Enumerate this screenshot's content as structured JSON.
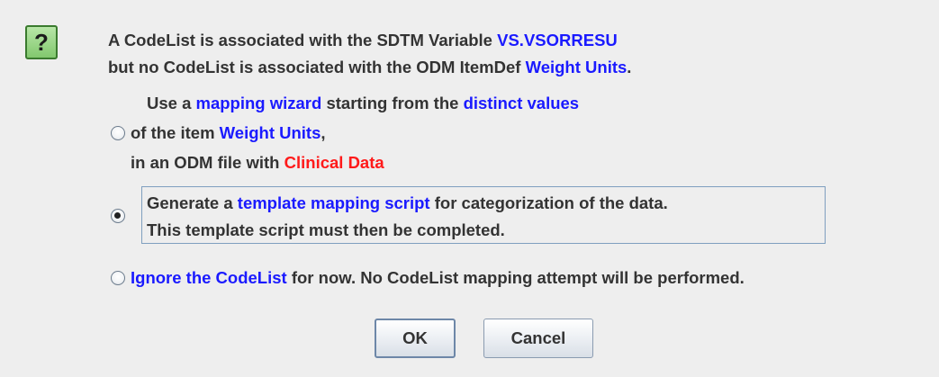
{
  "icon": {
    "name": "question-icon",
    "glyph": "?"
  },
  "message": {
    "line1": {
      "text": "A CodeList is associated with the SDTM Variable ",
      "highlight": "VS.VSORRESU"
    },
    "line2": {
      "text": "but no CodeList is associated with the ODM ItemDef ",
      "highlight": "Weight Units",
      "suffix": "."
    }
  },
  "options": [
    {
      "selected": false,
      "l1": {
        "a": "Use a ",
        "b": "mapping wizard",
        "c": " starting from the ",
        "d": "distinct values"
      },
      "l2": {
        "a": "of the item ",
        "b": "Weight Units",
        "c": ","
      },
      "l3": {
        "a": "in an ODM file with ",
        "b": "Clinical Data"
      }
    },
    {
      "selected": true,
      "l1": {
        "a": "Generate a ",
        "b": "template mapping script",
        "c": " for categorization of the data."
      },
      "l2": {
        "a": "This template script must then be completed."
      }
    },
    {
      "selected": false,
      "l1": {
        "a": "Ignore the CodeList",
        "b": " for now. No CodeList mapping attempt will be performed."
      }
    }
  ],
  "buttons": {
    "ok": "OK",
    "cancel": "Cancel"
  },
  "colors": {
    "highlight_blue": "#1a1aff",
    "highlight_red": "#ff1a1a",
    "background": "#eeeeee"
  }
}
